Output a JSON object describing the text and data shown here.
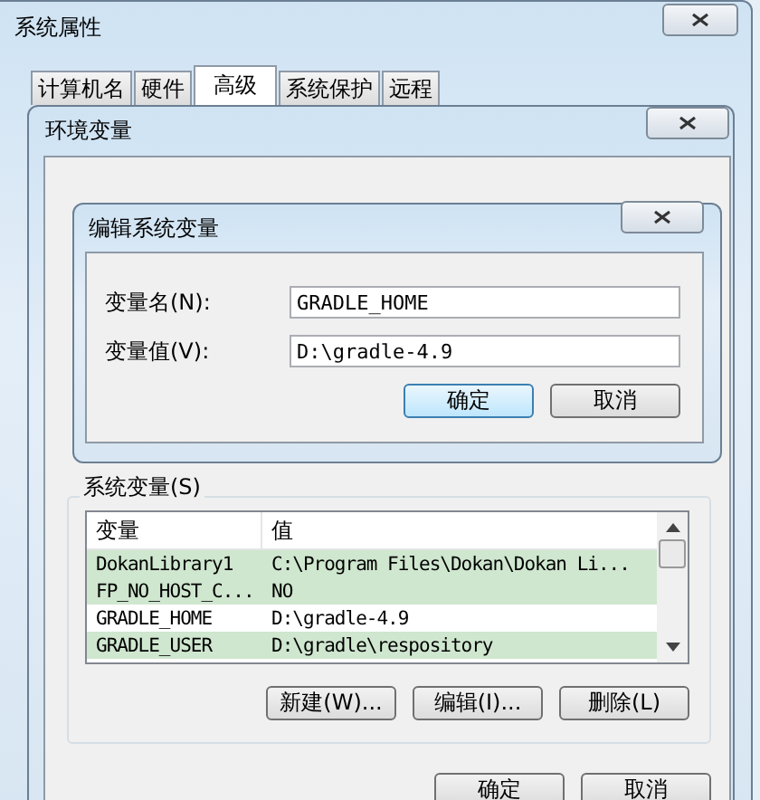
{
  "window": {
    "title": "系统属性"
  },
  "tabs": [
    {
      "label": "计算机名",
      "selected": false
    },
    {
      "label": "硬件",
      "selected": false
    },
    {
      "label": "高级",
      "selected": true
    },
    {
      "label": "系统保护",
      "selected": false
    },
    {
      "label": "远程",
      "selected": false
    }
  ],
  "env_dialog": {
    "title": "环境变量",
    "system_group": {
      "label": "系统变量(S)",
      "columns": [
        "变量",
        "值"
      ],
      "rows": [
        {
          "name": "DokanLibrary1",
          "value": "C:\\Program Files\\Dokan\\Dokan Li...",
          "selected": true
        },
        {
          "name": "FP_NO_HOST_C...",
          "value": "NO",
          "selected": true
        },
        {
          "name": "GRADLE_HOME",
          "value": "D:\\gradle-4.9",
          "selected": false
        },
        {
          "name": "GRADLE_USER",
          "value": "D:\\gradle\\respository",
          "selected": true
        }
      ],
      "buttons": [
        "新建(W)...",
        "编辑(I)...",
        "删除(L)"
      ]
    },
    "buttons": [
      "确定",
      "取消"
    ]
  },
  "edit_dialog": {
    "title": "编辑系统变量",
    "fields": [
      {
        "label": "变量名(N):",
        "value": "GRADLE_HOME"
      },
      {
        "label": "变量值(V):",
        "value": "D:\\gradle-4.9"
      }
    ],
    "buttons": [
      {
        "label": "确定",
        "default": true
      },
      {
        "label": "取消",
        "default": false
      }
    ]
  }
}
